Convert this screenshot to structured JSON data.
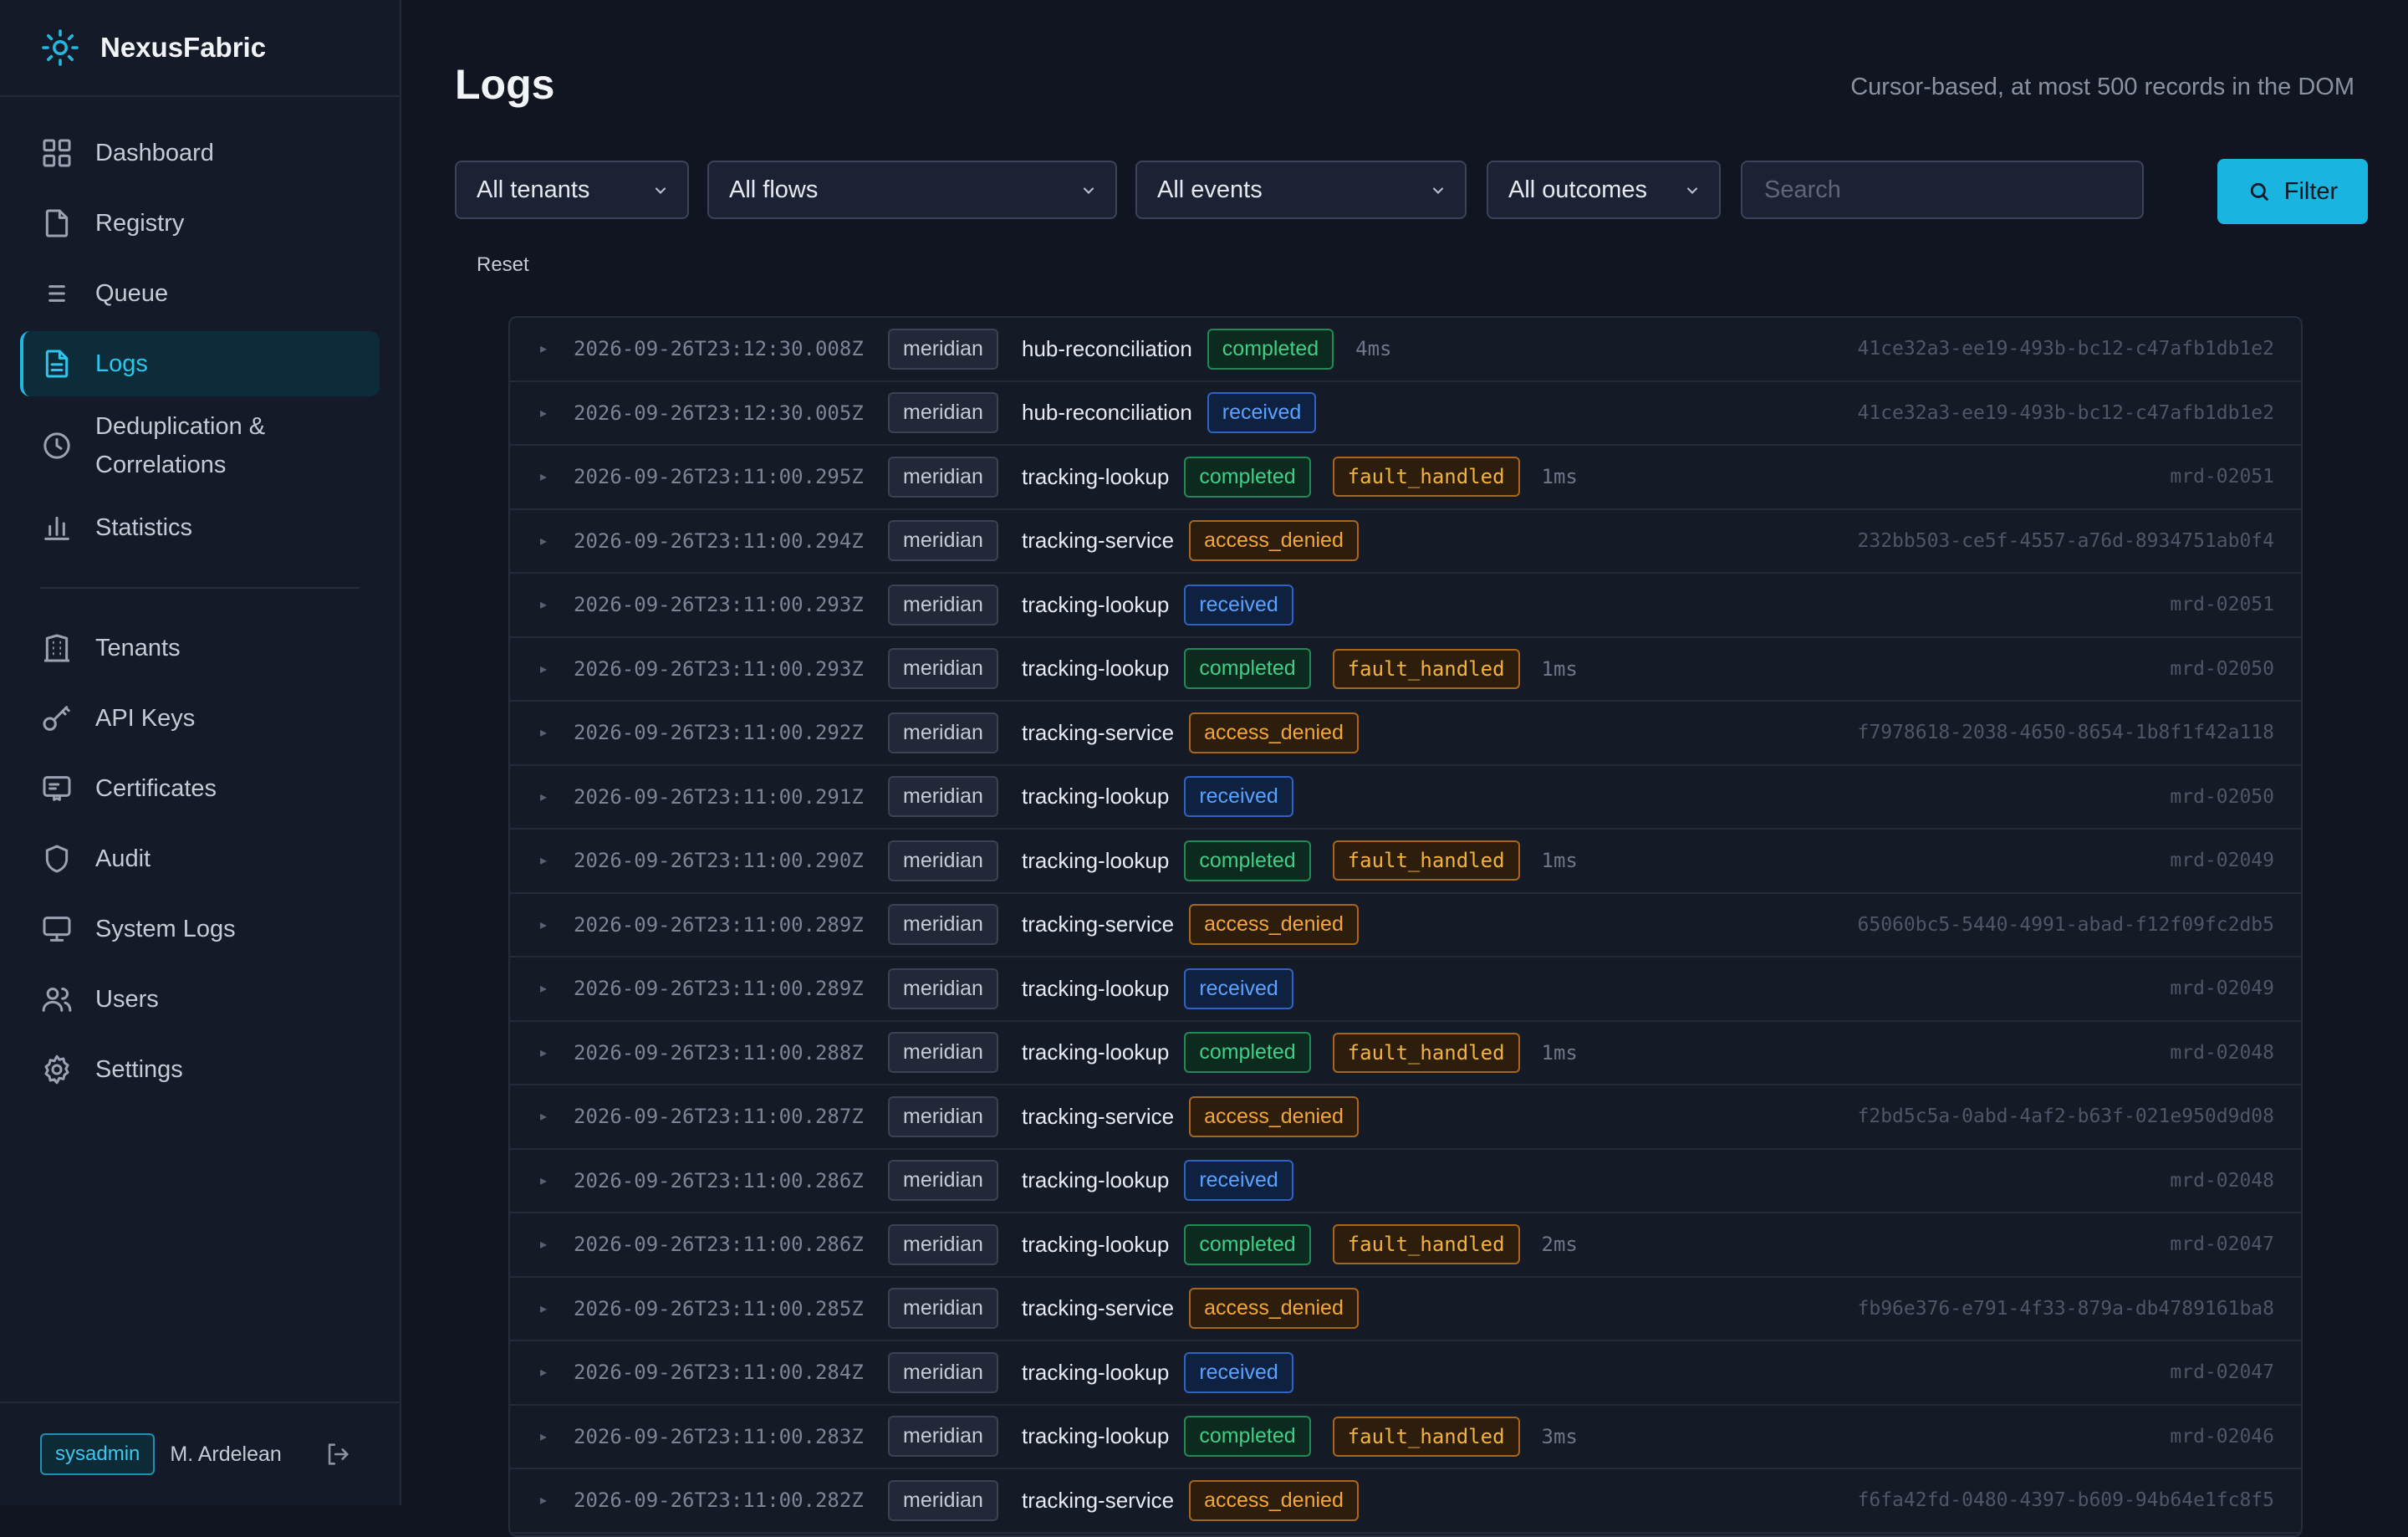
{
  "brand": {
    "name": "NexusFabric"
  },
  "sidebar": {
    "items": [
      {
        "label": "Dashboard",
        "icon": "grid-icon"
      },
      {
        "label": "Registry",
        "icon": "file-icon"
      },
      {
        "label": "Queue",
        "icon": "list-icon"
      },
      {
        "label": "Logs",
        "icon": "file-text-icon",
        "active": true
      },
      {
        "label": "Deduplication & Correlations",
        "icon": "clock-icon"
      },
      {
        "label": "Statistics",
        "icon": "bar-chart-icon"
      },
      {
        "label": "Tenants",
        "icon": "building-icon"
      },
      {
        "label": "API Keys",
        "icon": "key-icon"
      },
      {
        "label": "Certificates",
        "icon": "certificate-icon"
      },
      {
        "label": "Audit",
        "icon": "shield-icon"
      },
      {
        "label": "System Logs",
        "icon": "monitor-icon"
      },
      {
        "label": "Users",
        "icon": "users-icon"
      },
      {
        "label": "Settings",
        "icon": "gear-icon"
      }
    ],
    "footer": {
      "role": "sysadmin",
      "user": "M. Ardelean"
    }
  },
  "header": {
    "title": "Logs",
    "subtitle": "Cursor-based, at most 500 records in the DOM"
  },
  "filters": {
    "tenant": "All tenants",
    "flow": "All flows",
    "event": "All events",
    "outcome": "All outcomes",
    "search_placeholder": "Search",
    "filter_label": "Filter",
    "reset_label": "Reset"
  },
  "logs": [
    {
      "ts": "2026-09-26T23:12:30.008Z",
      "tenant": "meridian",
      "flow": "hub-reconciliation",
      "status": "completed",
      "fault": "",
      "duration": "4ms",
      "id": "41ce32a3-ee19-493b-bc12-c47afb1db1e2"
    },
    {
      "ts": "2026-09-26T23:12:30.005Z",
      "tenant": "meridian",
      "flow": "hub-reconciliation",
      "status": "received",
      "fault": "",
      "duration": "",
      "id": "41ce32a3-ee19-493b-bc12-c47afb1db1e2"
    },
    {
      "ts": "2026-09-26T23:11:00.295Z",
      "tenant": "meridian",
      "flow": "tracking-lookup",
      "status": "completed",
      "fault": "fault_handled",
      "duration": "1ms",
      "id": "mrd-02051"
    },
    {
      "ts": "2026-09-26T23:11:00.294Z",
      "tenant": "meridian",
      "flow": "tracking-service",
      "status": "access_denied",
      "fault": "",
      "duration": "",
      "id": "232bb503-ce5f-4557-a76d-8934751ab0f4"
    },
    {
      "ts": "2026-09-26T23:11:00.293Z",
      "tenant": "meridian",
      "flow": "tracking-lookup",
      "status": "received",
      "fault": "",
      "duration": "",
      "id": "mrd-02051"
    },
    {
      "ts": "2026-09-26T23:11:00.293Z",
      "tenant": "meridian",
      "flow": "tracking-lookup",
      "status": "completed",
      "fault": "fault_handled",
      "duration": "1ms",
      "id": "mrd-02050"
    },
    {
      "ts": "2026-09-26T23:11:00.292Z",
      "tenant": "meridian",
      "flow": "tracking-service",
      "status": "access_denied",
      "fault": "",
      "duration": "",
      "id": "f7978618-2038-4650-8654-1b8f1f42a118"
    },
    {
      "ts": "2026-09-26T23:11:00.291Z",
      "tenant": "meridian",
      "flow": "tracking-lookup",
      "status": "received",
      "fault": "",
      "duration": "",
      "id": "mrd-02050"
    },
    {
      "ts": "2026-09-26T23:11:00.290Z",
      "tenant": "meridian",
      "flow": "tracking-lookup",
      "status": "completed",
      "fault": "fault_handled",
      "duration": "1ms",
      "id": "mrd-02049"
    },
    {
      "ts": "2026-09-26T23:11:00.289Z",
      "tenant": "meridian",
      "flow": "tracking-service",
      "status": "access_denied",
      "fault": "",
      "duration": "",
      "id": "65060bc5-5440-4991-abad-f12f09fc2db5"
    },
    {
      "ts": "2026-09-26T23:11:00.289Z",
      "tenant": "meridian",
      "flow": "tracking-lookup",
      "status": "received",
      "fault": "",
      "duration": "",
      "id": "mrd-02049"
    },
    {
      "ts": "2026-09-26T23:11:00.288Z",
      "tenant": "meridian",
      "flow": "tracking-lookup",
      "status": "completed",
      "fault": "fault_handled",
      "duration": "1ms",
      "id": "mrd-02048"
    },
    {
      "ts": "2026-09-26T23:11:00.287Z",
      "tenant": "meridian",
      "flow": "tracking-service",
      "status": "access_denied",
      "fault": "",
      "duration": "",
      "id": "f2bd5c5a-0abd-4af2-b63f-021e950d9d08"
    },
    {
      "ts": "2026-09-26T23:11:00.286Z",
      "tenant": "meridian",
      "flow": "tracking-lookup",
      "status": "received",
      "fault": "",
      "duration": "",
      "id": "mrd-02048"
    },
    {
      "ts": "2026-09-26T23:11:00.286Z",
      "tenant": "meridian",
      "flow": "tracking-lookup",
      "status": "completed",
      "fault": "fault_handled",
      "duration": "2ms",
      "id": "mrd-02047"
    },
    {
      "ts": "2026-09-26T23:11:00.285Z",
      "tenant": "meridian",
      "flow": "tracking-service",
      "status": "access_denied",
      "fault": "",
      "duration": "",
      "id": "fb96e376-e791-4f33-879a-db4789161ba8"
    },
    {
      "ts": "2026-09-26T23:11:00.284Z",
      "tenant": "meridian",
      "flow": "tracking-lookup",
      "status": "received",
      "fault": "",
      "duration": "",
      "id": "mrd-02047"
    },
    {
      "ts": "2026-09-26T23:11:00.283Z",
      "tenant": "meridian",
      "flow": "tracking-lookup",
      "status": "completed",
      "fault": "fault_handled",
      "duration": "3ms",
      "id": "mrd-02046"
    },
    {
      "ts": "2026-09-26T23:11:00.282Z",
      "tenant": "meridian",
      "flow": "tracking-service",
      "status": "access_denied",
      "fault": "",
      "duration": "",
      "id": "f6fa42fd-0480-4397-b609-94b64e1fc8f5"
    }
  ]
}
